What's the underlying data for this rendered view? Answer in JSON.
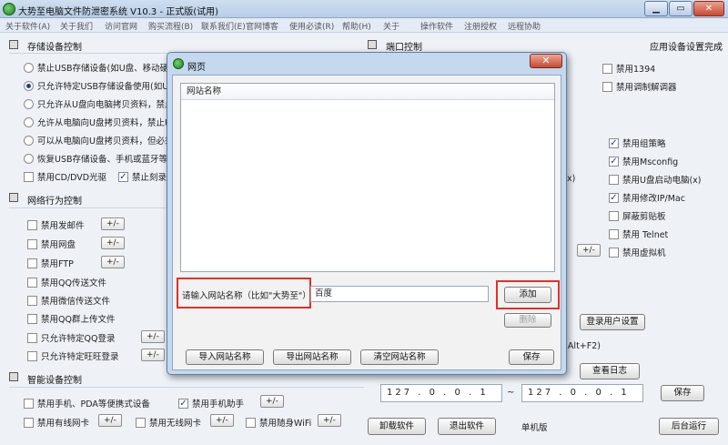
{
  "window": {
    "title": "大势至电脑文件防泄密系统 V10.3 - 正式版(试用)",
    "min": "▁",
    "max": "▭",
    "close": "✕"
  },
  "menu": [
    "关于软件(A)",
    "关于我们",
    "访问官网",
    "购买流程(B)",
    "联系我们(E)",
    "官网博客",
    "使用必读(R)",
    "帮助(H)",
    "关于",
    "操作软件",
    "注册授权",
    "远程协助"
  ],
  "storage": {
    "header": "存储设备控制",
    "options": [
      "禁止USB存储设备(如U盘、移动硬盘",
      "只允许特定USB存储设备使用(如U盘",
      "只允许从U盘向电脑拷贝资料，禁止",
      "允许从电脑向U盘拷贝资料，禁止U盘",
      "可以从电脑向U盘拷贝资料，但必须",
      "恢复USB存储设备、手机或蓝牙等设"
    ],
    "cd": "禁用CD/DVD光驱",
    "burn": "禁止刻录("
  },
  "port": {
    "header": "端口控制",
    "app_settings": "应用设备设置完成",
    "ieee1394": "禁用1394",
    "modem": "禁用调制解调器"
  },
  "right_checks": [
    "禁用组策略",
    "禁用Msconfig",
    "禁用U盘启动电脑(x)",
    "禁用修改IP/Mac",
    "屏蔽剪贴板",
    "禁用 Telnet",
    "禁用虚拟机"
  ],
  "right_fragment": "x)",
  "network": {
    "header": "网络行为控制",
    "items": [
      "禁用发邮件",
      "禁用网盘",
      "禁用FTP",
      "禁用QQ传送文件",
      "禁用微信传送文件",
      "禁用QQ群上传文件",
      "只允许特定QQ登录",
      "只允许特定旺旺登录"
    ],
    "pm": "+/-"
  },
  "smart": {
    "header": "智能设备控制",
    "phone": "禁用手机、PDA等便携式设备",
    "phone_helper": "禁用手机助手",
    "wired": "禁用有线网卡",
    "wireless": "禁用无线网卡",
    "wifi": "禁用随身WiFi"
  },
  "misc": {
    "login_settings": "登录用户设置",
    "hotkey": "): Alt+F2)",
    "view_log": "查看日志",
    "ip_from": "127 . 0 . 0 . 1",
    "tilde": "~",
    "ip_to": "127 . 0 . 0 . 1",
    "save": "保存",
    "uninstall": "卸载软件",
    "exit": "退出软件",
    "edition": "单机版",
    "background": "后台运行"
  },
  "dialog": {
    "title": "网页",
    "column": "网站名称",
    "prompt": "请输入网站名称（比如\"大势至\"）",
    "input_value": "百度",
    "add": "添加",
    "delete": "删除",
    "import": "导入网站名称",
    "export": "导出网站名称",
    "clear": "清空网站名称",
    "save": "保存"
  }
}
